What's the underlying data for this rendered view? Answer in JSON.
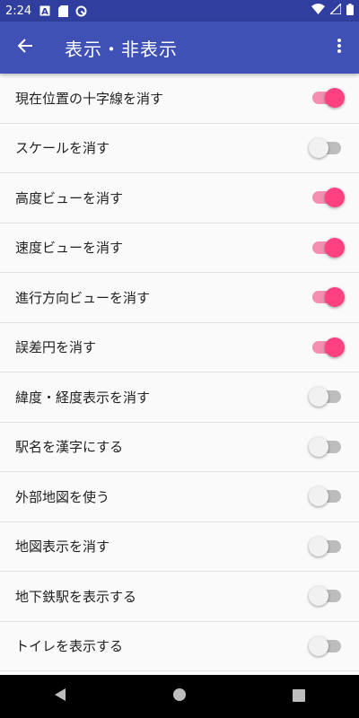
{
  "status_bar": {
    "time": "2:24",
    "battery_icon": "battery-full-icon",
    "wifi_icon": "wifi-icon",
    "signal_icon": "signal-icon"
  },
  "app_bar": {
    "title": "表示・非表示",
    "back_icon": "arrow-back-icon",
    "menu_icon": "more-vert-icon",
    "color": "#3f51b5"
  },
  "settings": [
    {
      "label": "現在位置の十字線を消す",
      "checked": true
    },
    {
      "label": "スケールを消す",
      "checked": false
    },
    {
      "label": "高度ビューを消す",
      "checked": true
    },
    {
      "label": "速度ビューを消す",
      "checked": true
    },
    {
      "label": "進行方向ビューを消す",
      "checked": true
    },
    {
      "label": "誤差円を消す",
      "checked": true
    },
    {
      "label": "緯度・経度表示を消す",
      "checked": false
    },
    {
      "label": "駅名を漢字にする",
      "checked": false
    },
    {
      "label": "外部地図を使う",
      "checked": false
    },
    {
      "label": "地図表示を消す",
      "checked": false
    },
    {
      "label": "地下鉄駅を表示する",
      "checked": false
    },
    {
      "label": "トイレを表示する",
      "checked": false
    }
  ],
  "colors": {
    "accent": "#ff4081",
    "status_bar": "#303f9f"
  }
}
